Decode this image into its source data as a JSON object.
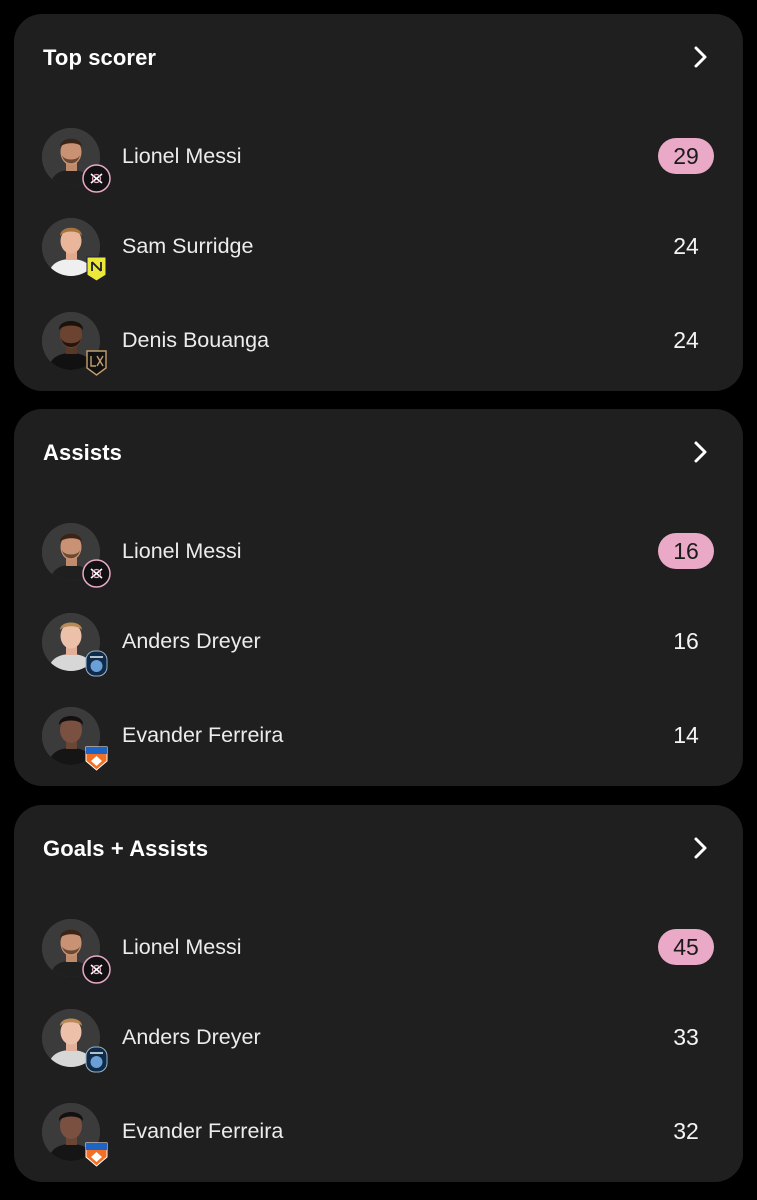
{
  "colors": {
    "page_background": "#000000",
    "card_background": "#1f1f1f",
    "leader_pill": "#e9a9c7",
    "text_primary": "#ffffff"
  },
  "cards": [
    {
      "title": "Top scorer",
      "rows": [
        {
          "name": "Lionel Messi",
          "value": "29",
          "team_icon": "inter-miami-crest-icon",
          "leader": true
        },
        {
          "name": "Sam Surridge",
          "value": "24",
          "team_icon": "nashville-sc-crest-icon",
          "leader": false
        },
        {
          "name": "Denis Bouanga",
          "value": "24",
          "team_icon": "lafc-crest-icon",
          "leader": false
        }
      ]
    },
    {
      "title": "Assists",
      "rows": [
        {
          "name": "Lionel Messi",
          "value": "16",
          "team_icon": "inter-miami-crest-icon",
          "leader": true
        },
        {
          "name": "Anders Dreyer",
          "value": "16",
          "team_icon": "san-diego-fc-crest-icon",
          "leader": false
        },
        {
          "name": "Evander Ferreira",
          "value": "14",
          "team_icon": "fc-cincinnati-crest-icon",
          "leader": false
        }
      ]
    },
    {
      "title": "Goals + Assists",
      "rows": [
        {
          "name": "Lionel Messi",
          "value": "45",
          "team_icon": "inter-miami-crest-icon",
          "leader": true
        },
        {
          "name": "Anders Dreyer",
          "value": "33",
          "team_icon": "san-diego-fc-crest-icon",
          "leader": false
        },
        {
          "name": "Evander Ferreira",
          "value": "32",
          "team_icon": "fc-cincinnati-crest-icon",
          "leader": false
        }
      ]
    }
  ]
}
